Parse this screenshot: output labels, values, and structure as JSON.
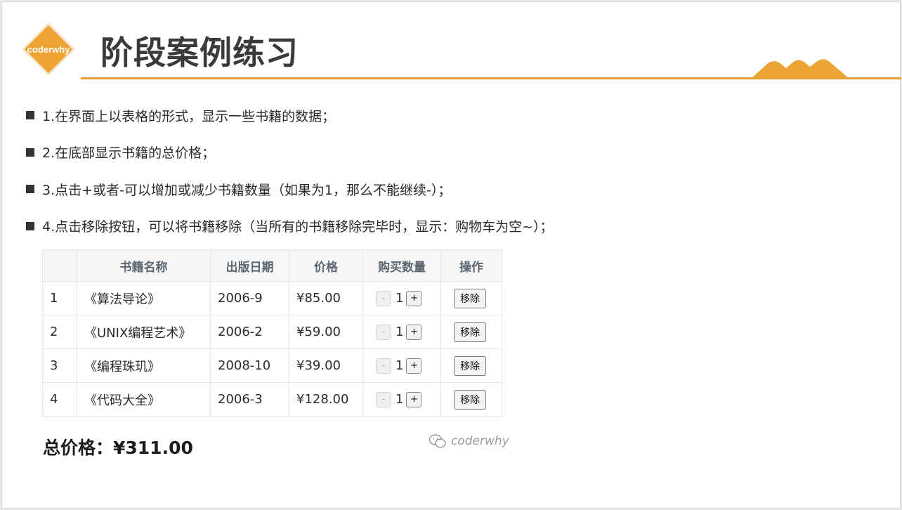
{
  "header": {
    "logo_text": "coderwhy",
    "title": "阶段案例练习",
    "accent_color": "#e8a030"
  },
  "bullets": [
    "1.在界面上以表格的形式，显示一些书籍的数据；",
    "2.在底部显示书籍的总价格；",
    "3.点击+或者-可以增加或减少书籍数量（如果为1，那么不能继续-）；",
    "4.点击移除按钮，可以将书籍移除（当所有的书籍移除完毕时，显示：购物车为空~）；"
  ],
  "table": {
    "headers": [
      "",
      "书籍名称",
      "出版日期",
      "价格",
      "购买数量",
      "操作"
    ],
    "rows": [
      {
        "index": "1",
        "name": "《算法导论》",
        "date": "2006-9",
        "price": "¥85.00",
        "qty": "1"
      },
      {
        "index": "2",
        "name": "《UNIX编程艺术》",
        "date": "2006-2",
        "price": "¥59.00",
        "qty": "1"
      },
      {
        "index": "3",
        "name": "《编程珠玑》",
        "date": "2008-10",
        "price": "¥39.00",
        "qty": "1"
      },
      {
        "index": "4",
        "name": "《代码大全》",
        "date": "2006-3",
        "price": "¥128.00",
        "qty": "1"
      }
    ],
    "minus_label": "-",
    "plus_label": "+",
    "remove_label": "移除"
  },
  "total": "总价格：¥311.00",
  "watermark": "coderwhy"
}
